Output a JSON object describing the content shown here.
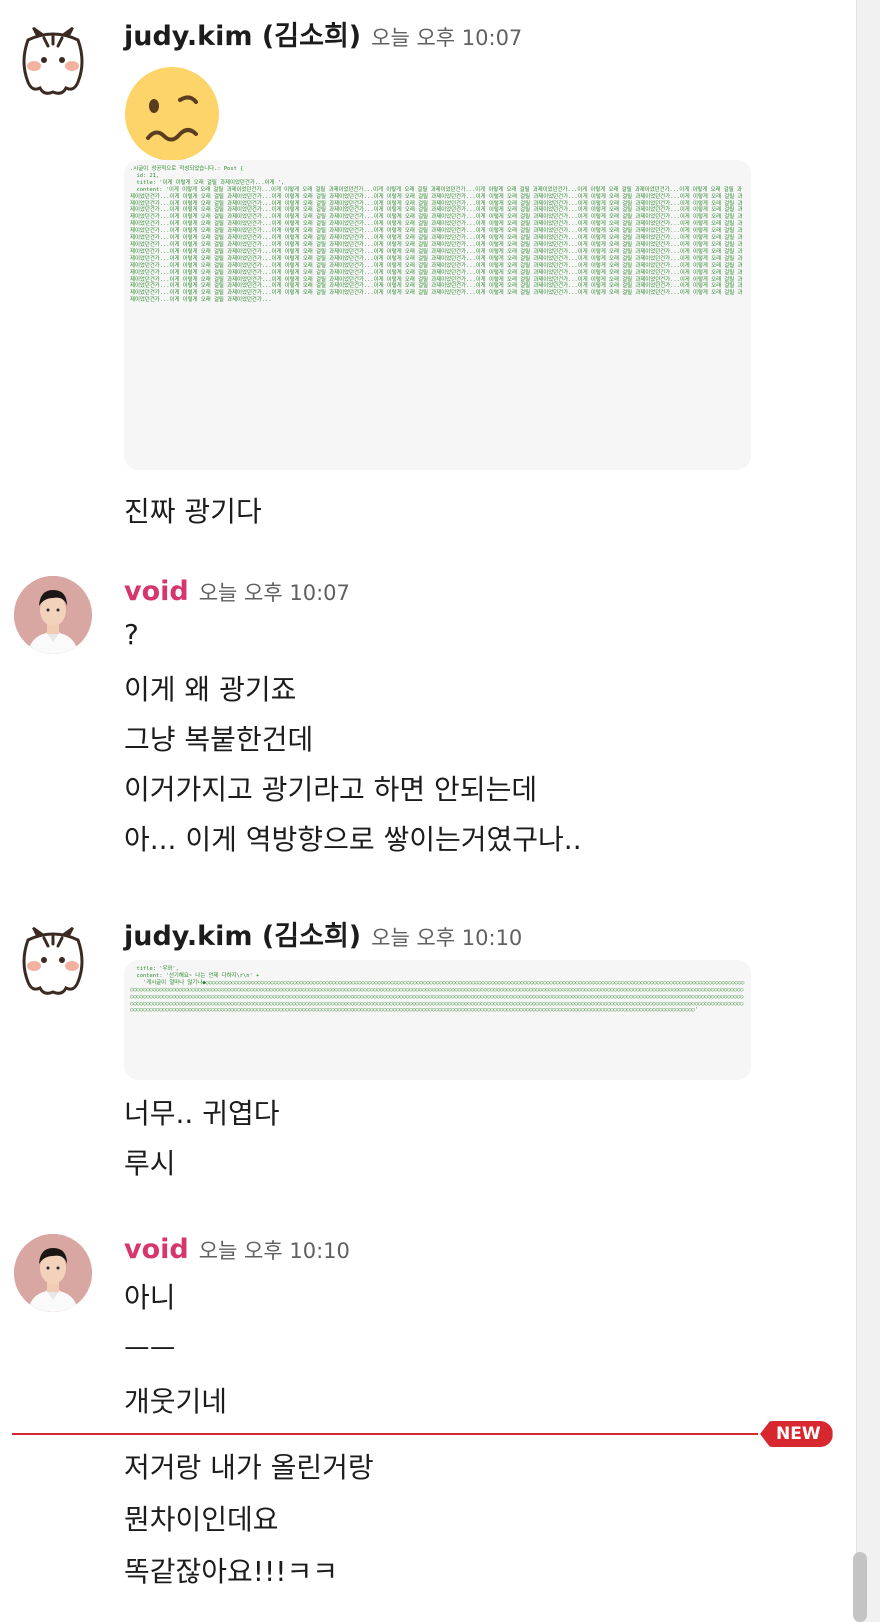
{
  "messages": [
    {
      "sender": "judy.kim (김소희)",
      "time": "오늘 오후 10:07",
      "code_image_text": ".시글이 성공적으로 작성되었습니다.: Post {\n  id: 21,\n  title: '이게 이렇게 오래 걸릴 과제이었던건가...이게 ',\n  content: '이게 이렇게 오래 걸릴 과제이었던건가...이게 이렇게 오래 걸릴 과제이었던건가...이게 이렇게 오래 걸릴 과제이었던건가...이게 이렇게 오래 걸릴 과제이었던건가...이게 이렇게 오래 걸릴 과제이었던건가...이게 이렇게 오래 걸릴 과제이었던건가...이게 이렇게 오래 걸릴 과제이었던건가...이게 이렇게 오래 걸릴 과제이었던건가...이게 이렇게 오래 걸릴 과제이었던건가...이게 이렇게 오래 걸릴 과제이었던건가...이게 이렇게 오래 걸릴 과제이었던건가...이게 이렇게 오래 걸릴 과제이었던건가...이게 이렇게 오래 걸릴 과제이었던건가...이게 이렇게 오래 걸릴 과제이었던건가...이게 이렇게 오래 걸릴 과제이었던건가...이게 이렇게 오래 걸릴 과제이었던건가...이게 이렇게 오래 걸릴 과제이었던건가...이게 이렇게 오래 걸릴 과제이었던건가...이게 이렇게 오래 걸릴 과제이었던건가...이게 이렇게 오래 걸릴 과제이었던건가...이게 이렇게 오래 걸릴 과제이었던건가...이게 이렇게 오래 걸릴 과제이었던건가...이게 이렇게 오래 걸릴 과제이었던건가...이게 이렇게 오래 걸릴 과제이었던건가...이게 이렇게 오래 걸릴 과제이었던건가...이게 이렇게 오래 걸릴 과제이었던건가...이게 이렇게 오래 걸릴 과제이었던건가...이게 이렇게 오래 걸릴 과제이었던건가...이게 이렇게 오래 걸릴 과제이었던건가...이게 이렇게 오래 걸릴 과제이었던건가...이게 이렇게 오래 걸릴 과제이었던건가...이게 이렇게 오래 걸릴 과제이었던건가...이게 이렇게 오래 걸릴 과제이었던건가...이게 이렇게 오래 걸릴 과제이었던건가...이게 이렇게 오래 걸릴 과제이었던건가...이게 이렇게 오래 걸릴 과제이었던건가...이게 이렇게 오래 걸릴 과제이었던건가...이게 이렇게 오래 걸릴 과제이었던건가...이게 이렇게 오래 걸릴 과제이었던건가...이게 이렇게 오래 걸릴 과제이었던건가...이게 이렇게 오래 걸릴 과제이었던건가...이게 이렇게 오래 걸릴 과제이었던건가...이게 이렇게 오래 걸릴 과제이었던건가...이게 이렇게 오래 걸릴 과제이었던건가...이게 이렇게 오래 걸릴 과제이었던건가...이게 이렇게 오래 걸릴 과제이었던건가...이게 이렇게 오래 걸릴 과제이었던건가...이게 이렇게 오래 걸릴 과제이었던건가...이게 이렇게 오래 걸릴 과제이었던건가...이게 이렇게 오래 걸릴 과제이었던건가...이게 이렇게 오래 걸릴 과제이었던건가...이게 이렇게 오래 걸릴 과제이었던건가...이게 이렇게 오래 걸릴 과제이었던건가...이게 이렇게 오래 걸릴 과제이었던건가...이게 이렇게 오래 걸릴 과제이었던건가...이게 이렇게 오래 걸릴 과제이었던건가...이게 이렇게 오래 걸릴 과제이었던건가...이게 이렇게 오래 걸릴 과제이었던건가...이게 이렇게 오래 걸릴 과제이었던건가...이게 이렇게 오래 걸릴 과제이었던건가...이게 이렇게 오래 걸릴 과제이었던건가...이게 이렇게 오래 걸릴 과제이었던건가...이게 이렇게 오래 걸릴 과제이었던건가...이게 이렇게 오래 걸릴 과제이었던건가...이게 이렇게 오래 걸릴 과제이었던건가...이게 이렇게 오래 걸릴 과제이었던건가...이게 이렇게 오래 걸릴 과제이었던건가...이게 이렇게 오래 걸릴 과제이었던건가...이게 이렇게 오래 걸릴 과제이었던건가...이게 이렇게 오래 걸릴 과제이었던건가...이게 이렇게 오래 걸릴 과제이었던건가...이게 이렇게 오래 걸릴 과제이었던건가...이게 이렇게 오래 걸릴 과제이었던건가...이게 이렇게 오래 걸릴 과제이었던건가...이게 이렇게 오래 걸릴 과제이었던건가...이게 이렇게 오래 걸릴 과제이었던건가...이게 이렇게 오래 걸릴 과제이었던건가...이게 이렇게 오래 걸릴 과제이었던건가...이게 이렇게 오래 걸릴 과제이었던건가...이게 이렇게 오래 걸릴 과제이었던건가...이게 이렇게 오래 걸릴 과제이었던건가...이게 이렇게 오래 걸릴 과제이었던건가...이게 이렇게 오래 걸릴 과제이었던건가...이게 이렇게 오래 걸릴 과제이었던건가...이게 이렇게 오래 걸릴 과제이었던건가...이게 이렇게 오래 걸릴 과제이었던건가...이게 이렇게 오래 걸릴 과제이었던건가...이게 이렇게 오래 걸릴 과제이었던건가...이게 이렇게 오래 걸릴 과제이었던건가...이게 이렇게 오래 걸릴 과제이었던건가...이게 이렇게 오래 걸릴 과제이었던건가...이게 이렇게 오래 걸릴 과제이었던건가...이게 이렇게 오래 걸릴 과제이었던건가...이게 이렇게 오래 걸릴 과제이었던건가...이게 이렇게 오래 걸릴 과제이었던건가...이게 이렇게 오래 걸릴 과제이었던건가...이게 이렇게 오래 걸릴 과제이었던건가...",
      "lines": [
        "진짜 광기다"
      ]
    },
    {
      "sender": "void",
      "time": "오늘 오후 10:07",
      "lines": [
        "?",
        "이게 왜 광기죠",
        "그냥 복붙한건데",
        "이거가지고 광기라고 하면 안되는데",
        "아... 이게 역방향으로 쌓이는거였구나.."
      ]
    },
    {
      "sender": "judy.kim (김소희)",
      "time": "오늘 오후 10:10",
      "code_image_text": "  title: '우와',\n  content: '선기해요~ 나는 언제 다하지\\r\\n' +\n    '게시글이 얼마나 많기나●○○○○○○○○○○○○○○○○○○○○○○○○○○○○○○○○○○○○○○○○○○○○○○○○○○○○○○○○○○○○○○○○○○○○○○○○○○○○○○○○○○○○○○○○○○○○○○○○○○○○○○○○○○○○○○○○○○○○○○○○○○○○○○○○○○○○○○○○○○○○○○○○○○○○○○○○○○○○○○○○○○○○○○○○○○○○○○○○○○○○○○○○○○○○○○○○○○○○○○○○○○○○○○○○○○○○○○○○○○○○○○○○○○○○○○○○○○○○○○○○○○○○○○○○○○○○○○○○○○○○○○○○○○○○○○○○○○○○○○○○○○○○○○○○○○○○○○○○○○○○○○○○○○○○○○○○○○○○○○○○○○○○○○○○○○○○○○○○○○○○○○○○○○○○○○○○○○○○○○○○○○○○○○○○○○○○○○○○○○○○○○○○○○○○○○○○○○○○○○○○○○○○○○○○○○○○○○○○○○○○○○○○○○○○○○○○○○○○○○○○○○○○○○○○○○○○○○○○○○○○○○○○○○○○○○○○○○○○○○○○○○○○○○○○○○○○○○○○○○○○○○○○○○○○○○○○○○○○○○○○○○○○○○○○○○○○○○○○○○○○○○○○○○○○○○○○○○○○○○○○○○○○○○○○○○○○○○○○○○○○○○○○○○○○○○○○○○○○○○○○○○○○○○○○○○○○○○○○○○○○○○○○○○○○○○○○○○○○○○○○○○○○○○○○○○○○○○○○○○○○○○○○○○○○○○○○○○○○○○○○○○○○○○○○○○○○○○○○○○○○○○○○○○○○○○○○○○○○○○○○○○○○○○○○○○○○○○○○○○○○○○○○○○○○○○○○○○○○○○○○○○○○○○○○○○○○○○○○○○○○○○○○○○○○○○○○○○○○○○○○○○○○○○○○○○○○○○○○○○○○○○○○○○○○○○○○○○○○○○○○○○○○○○○○○○○○○○○○○○○○○○○○○○○○○○○○○○○○○○○○○○○○○○○○○○○○○○○○○○○○○○○○○○○'",
      "lines": [
        "너무.. 귀엽다",
        "루시"
      ]
    },
    {
      "sender": "void",
      "time": "오늘 오후 10:10",
      "lines": [
        "아니",
        "ㅡㅡ",
        "개웃기네",
        "저거랑 내가 올린거랑",
        "뭔차이인데요",
        "똑같잖아요!!!ㅋㅋ"
      ]
    }
  ],
  "new_divider_label": "NEW",
  "colors": {
    "void_name": "#d6366b",
    "new_marker": "#d8282f"
  }
}
